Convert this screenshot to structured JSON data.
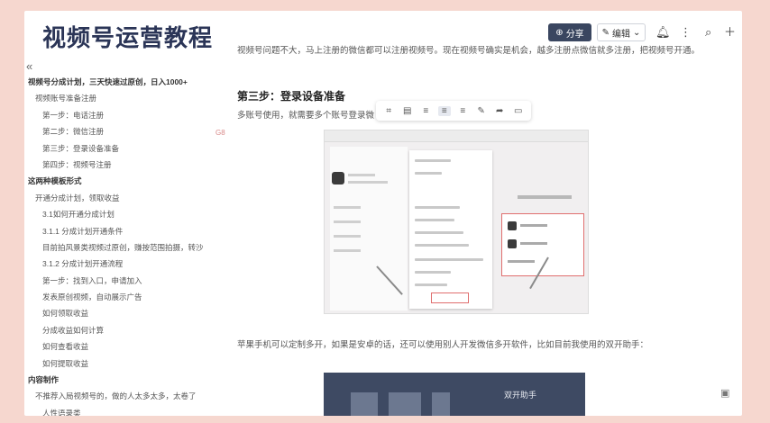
{
  "header": {
    "title": "视频号运营教程",
    "share_label": "分享",
    "share_icon": "person-plus-icon",
    "edit_label": "编辑",
    "edit_icon": "pencil-icon",
    "icons": [
      "bell-icon",
      "more-icon",
      "search-icon",
      "plus-icon"
    ]
  },
  "sidebar": {
    "collapse_glyph": "«",
    "items": [
      {
        "label": "视频号分成计划，三天快速过原创，日入1000+",
        "level": 0
      },
      {
        "label": "视频账号准备注册",
        "level": 1
      },
      {
        "label": "第一步：电话注册",
        "level": 2
      },
      {
        "label": "第二步：微信注册",
        "level": 2
      },
      {
        "label": "第三步：登录设备准备",
        "level": 2
      },
      {
        "label": "第四步：视频号注册",
        "level": 2
      },
      {
        "label": "这两种模板形式",
        "level": 0
      },
      {
        "label": "开通分成计划，领取收益",
        "level": 1
      },
      {
        "label": "3.1如何开通分成计划",
        "level": 2
      },
      {
        "label": "3.1.1 分成计划开通条件",
        "level": 2
      },
      {
        "label": "目前拍风景类视频过原创，赚按范围拍摄，转沙",
        "level": 2
      },
      {
        "label": "3.1.2 分成计划开通流程",
        "level": 2
      },
      {
        "label": "第一步：找到入口，申请加入",
        "level": 2
      },
      {
        "label": "发表原创视频，自动展示广告",
        "level": 2
      },
      {
        "label": "如何领取收益",
        "level": 2
      },
      {
        "label": "分成收益如何计算",
        "level": 2
      },
      {
        "label": "如何查看收益",
        "level": 2
      },
      {
        "label": "如何提取收益",
        "level": 2
      },
      {
        "label": "内容制作",
        "level": 0
      },
      {
        "label": "不推荐入局视频号的，做的人太多太多，太卷了",
        "level": 1
      },
      {
        "label": "人性语录类",
        "level": 2
      }
    ]
  },
  "content": {
    "para1": "视频号问题不大，马上注册的微信都可以注册视频号。现在视频号确实是机会，越多注册点微信就多注册，把视频号开通。",
    "heading": "第三步：登录设备准备",
    "para2": "多账号使用，就需要多个账号登录微",
    "bottom_para": "苹果手机可以定制多开，如果是安卓的话，还可以使用别人开发微信多开软件，比如目前我使用的双开助手：",
    "bottom_shot_label": "双开助手",
    "side_badge": "G8"
  },
  "toolbar": {
    "icons": [
      "crop-icon",
      "replace-icon",
      "align-left-icon",
      "align-center-icon",
      "align-right-icon",
      "edit-image-icon",
      "share-icon",
      "comment-icon"
    ]
  }
}
